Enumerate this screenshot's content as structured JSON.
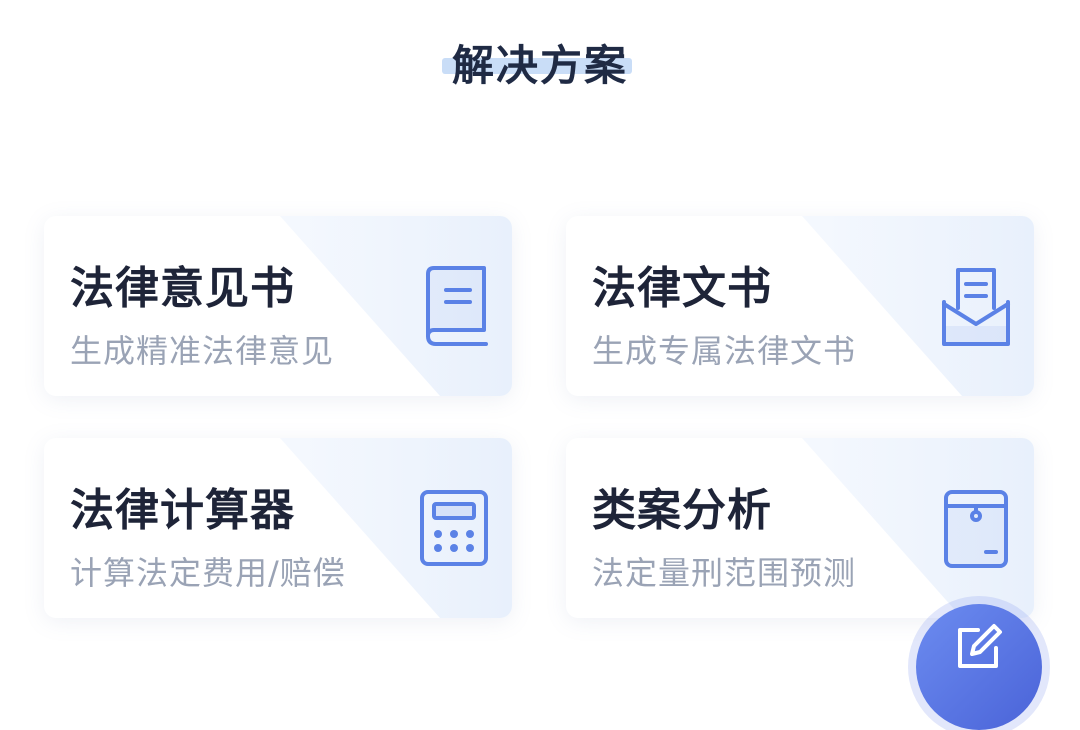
{
  "section": {
    "title": "解决方案"
  },
  "cards": [
    {
      "title": "法律意见书",
      "subtitle": "生成精准法律意见",
      "icon": "book-icon"
    },
    {
      "title": "法律文书",
      "subtitle": "生成专属法律文书",
      "icon": "document-envelope-icon"
    },
    {
      "title": "法律计算器",
      "subtitle": "计算法定费用/赔偿",
      "icon": "calculator-icon"
    },
    {
      "title": "类案分析",
      "subtitle": "法定量刑范围预测",
      "icon": "case-folder-icon"
    }
  ],
  "fab": {
    "icon": "edit-icon"
  },
  "colors": {
    "accent": "#4a6fd8",
    "icon_blue": "#5b82e6",
    "title_text": "#1e2438",
    "subtitle_text": "#9aa3b5",
    "title_highlight": "#c9ddf7"
  }
}
